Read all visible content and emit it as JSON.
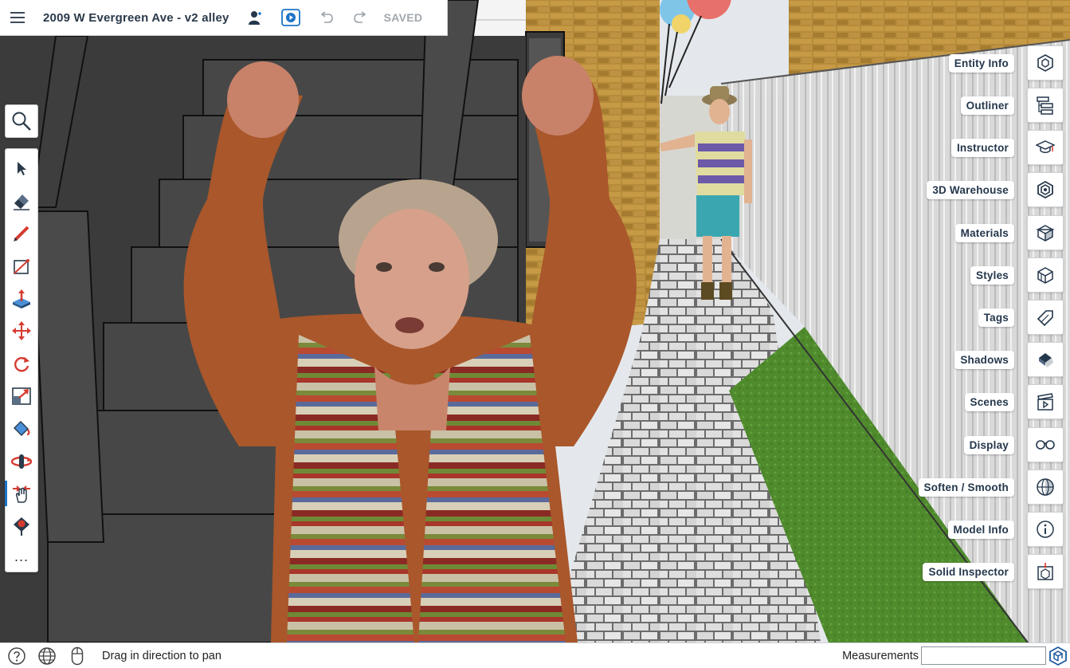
{
  "app": {
    "document_title": "2009 W Evergreen Ave - v2 alley",
    "save_status": "SAVED"
  },
  "topbar": {
    "icons": [
      "menu-icon",
      "collaborator-icon",
      "present-play-icon",
      "undo-icon",
      "redo-icon"
    ]
  },
  "left_toolbar": {
    "search_icon": "magnify-icon",
    "tools": [
      {
        "name": "select-tool",
        "icon": "arrow-cursor"
      },
      {
        "name": "eraser-tool",
        "icon": "eraser"
      },
      {
        "name": "pencil-line-tool",
        "icon": "pencil"
      },
      {
        "name": "rectangle-tool",
        "icon": "rectangle"
      },
      {
        "name": "push-pull-tool",
        "icon": "push-pull"
      },
      {
        "name": "move-tool",
        "icon": "move-arrows"
      },
      {
        "name": "rotate-tool",
        "icon": "rotate"
      },
      {
        "name": "scale-tool",
        "icon": "scale"
      },
      {
        "name": "paint-bucket-tool",
        "icon": "paint-bucket"
      },
      {
        "name": "orbit-tool",
        "icon": "orbit"
      },
      {
        "name": "pan-tool",
        "icon": "hand",
        "active": true
      },
      {
        "name": "walk-tool",
        "icon": "pin"
      },
      {
        "name": "more-tools",
        "icon": "ellipsis"
      }
    ],
    "more_label": "..."
  },
  "right_panels": [
    {
      "label": "Entity Info",
      "icon": "entity-info-icon"
    },
    {
      "label": "Outliner",
      "icon": "outliner-icon"
    },
    {
      "label": "Instructor",
      "icon": "instructor-cap-icon"
    },
    {
      "label": "3D Warehouse",
      "icon": "warehouse-icon"
    },
    {
      "label": "Materials",
      "icon": "materials-cube-icon"
    },
    {
      "label": "Styles",
      "icon": "styles-cube-icon"
    },
    {
      "label": "Tags",
      "icon": "tag-icon"
    },
    {
      "label": "Shadows",
      "icon": "shadows-icon"
    },
    {
      "label": "Scenes",
      "icon": "scenes-clapper-icon"
    },
    {
      "label": "Display",
      "icon": "display-glasses-icon"
    },
    {
      "label": "Soften / Smooth",
      "icon": "soften-sphere-icon"
    },
    {
      "label": "Model Info",
      "icon": "info-circle-icon"
    },
    {
      "label": "Solid Inspector",
      "icon": "solid-inspector-icon"
    }
  ],
  "statusbar": {
    "hint": "Drag in direction to pan",
    "measurements_label": "Measurements",
    "measurements_value": ""
  },
  "colors": {
    "accent": "#1c74c6",
    "label_text": "#24374c",
    "saved_text": "#a2a8ae"
  }
}
